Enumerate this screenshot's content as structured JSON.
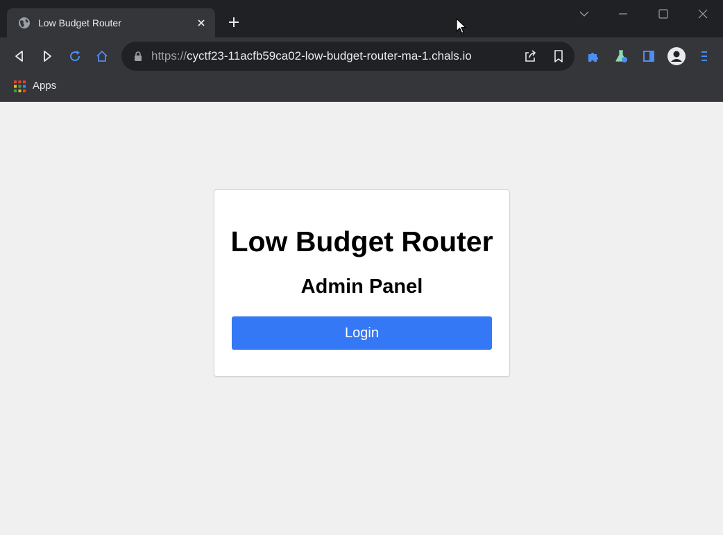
{
  "browser": {
    "tab": {
      "title": "Low Budget Router",
      "favicon_icon": "globe-icon",
      "close_icon": "close-icon"
    },
    "new_tab_icon": "plus-icon",
    "window_controls": [
      "chevron-down-icon",
      "minimize-icon",
      "maximize-icon",
      "close-icon"
    ],
    "toolbar": {
      "back_icon": "back-icon",
      "forward_icon": "forward-icon",
      "reload_icon": "reload-icon",
      "home_icon": "home-icon",
      "url_scheme": "https://",
      "url_host": "cyctf23-11acfb59ca02-low-budget-router-ma-1.chals.io",
      "share_icon": "share-icon",
      "bookmark_icon": "bookmark-icon",
      "extensions_icon": "puzzle-icon",
      "labs_icon": "flask-icon",
      "side_panel_icon": "side-panel-icon",
      "profile_icon": "avatar-icon",
      "menu_icon": "menu-icon"
    },
    "bookmarks_bar": {
      "apps_label": "Apps",
      "apps_icon": "apps-grid-icon"
    }
  },
  "page": {
    "title": "Low Budget Router",
    "subtitle": "Admin Panel",
    "login_label": "Login"
  },
  "colors": {
    "accent": "#3478f6",
    "page_background": "#f0f0f0",
    "browser_frame": "#202124",
    "toolbar": "#35363a"
  }
}
